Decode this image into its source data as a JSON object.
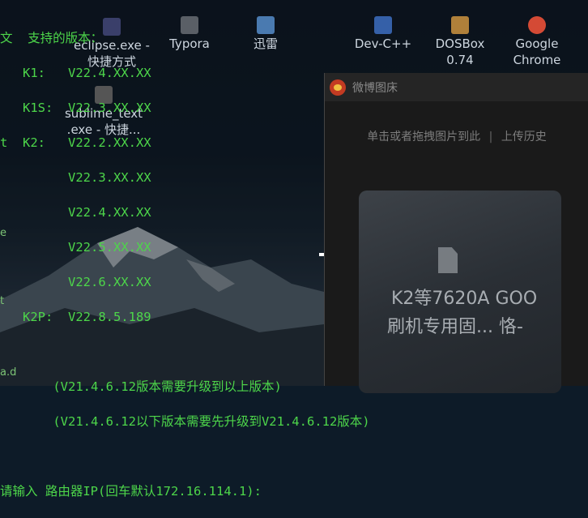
{
  "desktop_icons": [
    {
      "label": "eclipse.exe -",
      "label2": "快捷方式",
      "icon": "eclipse-icon",
      "color": "#3a3f6a"
    },
    {
      "label": "Typora",
      "label2": "",
      "icon": "typora-icon",
      "color": "#5a5f66"
    },
    {
      "label": "迅雷",
      "label2": "",
      "icon": "xunlei-icon",
      "color": "#4a7ab0"
    },
    {
      "label": "Dev-C++",
      "label2": "",
      "icon": "devcpp-icon",
      "color": "#3560a8"
    },
    {
      "label": "DOSBox",
      "label2": "0.74",
      "icon": "dosbox-icon",
      "color": "#b0803a"
    },
    {
      "label": "Google",
      "label2": "Chrome",
      "icon": "chrome-icon",
      "color": "#d44a35"
    },
    {
      "label": "sublime_text",
      "label2": ".exe - 快捷...",
      "icon": "sublime-icon",
      "color": "#555"
    }
  ],
  "console": {
    "line1": "文  支持的版本：",
    "line2": "   K1:   V22.4.XX.XX",
    "line3": "   K1S:  V22.3.XX.XX",
    "line4": "t  K2:   V22.2.XX.XX",
    "line5": "         V22.3.XX.XX",
    "line6": "         V22.4.XX.XX",
    "line7": "         V22.5.XX.XX",
    "line8": "         V22.6.XX.XX",
    "line9": "   K2P:  V22.8.5.189",
    "line10": "",
    "line11": "       (V21.4.6.12版本需要升级到以上版本)",
    "line12": "       (V21.4.6.12以下版本需要先升级到V21.4.6.12版本)",
    "line13": "",
    "line14": "请输入 路由器IP(回车默认172.16.114.1):"
  },
  "weibo_window": {
    "title": "微博图床",
    "upload_hint": "单击或者拖拽图片到此",
    "separator": "|",
    "history_link": "上传历史",
    "card_line1": "K2等7620A   GOO",
    "card_line2": "刷机专用固...   恪-"
  },
  "edge_letters": [
    "e",
    "t",
    "a.d"
  ]
}
